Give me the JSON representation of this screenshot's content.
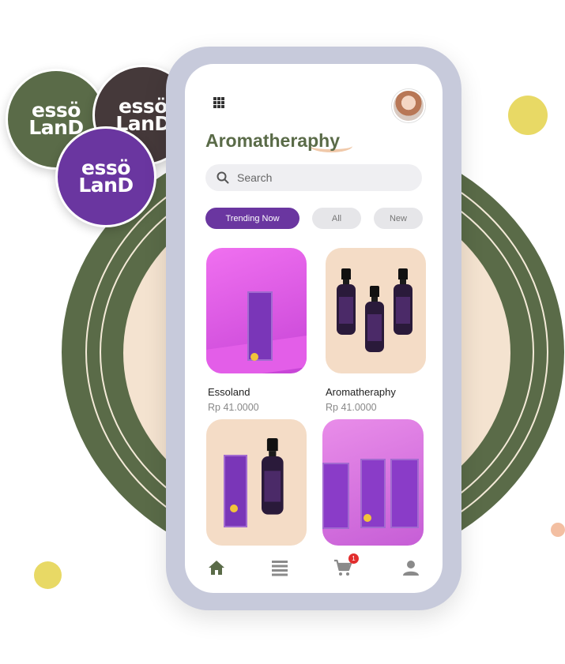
{
  "colors": {
    "olive": "#5a6b48",
    "purple": "#6a36a0",
    "brown": "#45393a",
    "peach": "#f4e3d0",
    "yellow": "#e8d965"
  },
  "logos": [
    {
      "line1": "essö",
      "line2": "LanD"
    },
    {
      "line1": "essö",
      "line2": "LanD"
    },
    {
      "line1": "essö",
      "line2": "LanD"
    }
  ],
  "header": {
    "menu_icon": "grid-icon",
    "avatar_icon": "user-avatar"
  },
  "page_title": "Aromatheraphy",
  "search": {
    "placeholder": "Search",
    "icon": "search-icon"
  },
  "filters": [
    {
      "label": "Trending Now",
      "active": true
    },
    {
      "label": "All",
      "active": false
    },
    {
      "label": "New",
      "active": false
    }
  ],
  "products": [
    {
      "name": "Essoland",
      "price": "Rp 41.0000"
    },
    {
      "name": "Aromatheraphy",
      "price": "Rp 41.0000"
    }
  ],
  "bottom_nav": {
    "items": [
      "home-icon",
      "list-icon",
      "cart-icon",
      "profile-icon"
    ],
    "cart_count": "1"
  }
}
